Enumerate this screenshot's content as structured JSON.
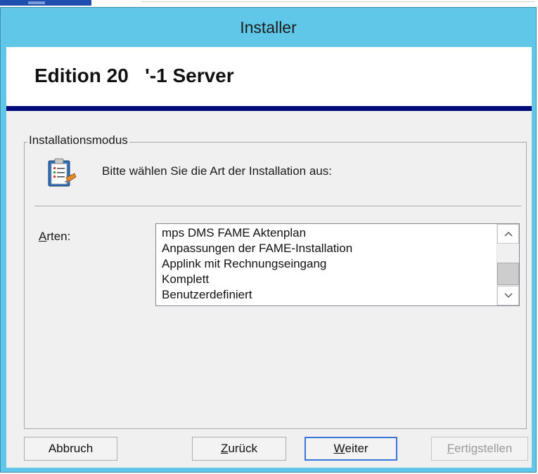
{
  "window": {
    "title": "Installer"
  },
  "header": {
    "title": "Edition 20   '-1 Server"
  },
  "group": {
    "legend": "Installationsmodus",
    "instruction": "Bitte wählen Sie die Art der Installation aus:",
    "icon": "installer-checklist-icon"
  },
  "arten": {
    "label_accel": "A",
    "label_rest": "rten:",
    "items": [
      "mps DMS FAME Aktenplan",
      "Anpassungen der FAME-Installation",
      "Applink mit Rechnungseingang",
      "Komplett",
      "Benutzerdefiniert"
    ]
  },
  "scrollbar": {
    "up_glyph": "^",
    "down_glyph": "v"
  },
  "buttons": {
    "cancel": "Abbruch",
    "back_accel": "Z",
    "back_rest": "urück",
    "next_accel": "W",
    "next_rest": "eiter",
    "finish_accel": "F",
    "finish_rest": "ertigstellen"
  },
  "colors": {
    "titlebar": "#61c7e8",
    "header_rule": "#000a78",
    "default_button_border": "#3b73d8"
  }
}
